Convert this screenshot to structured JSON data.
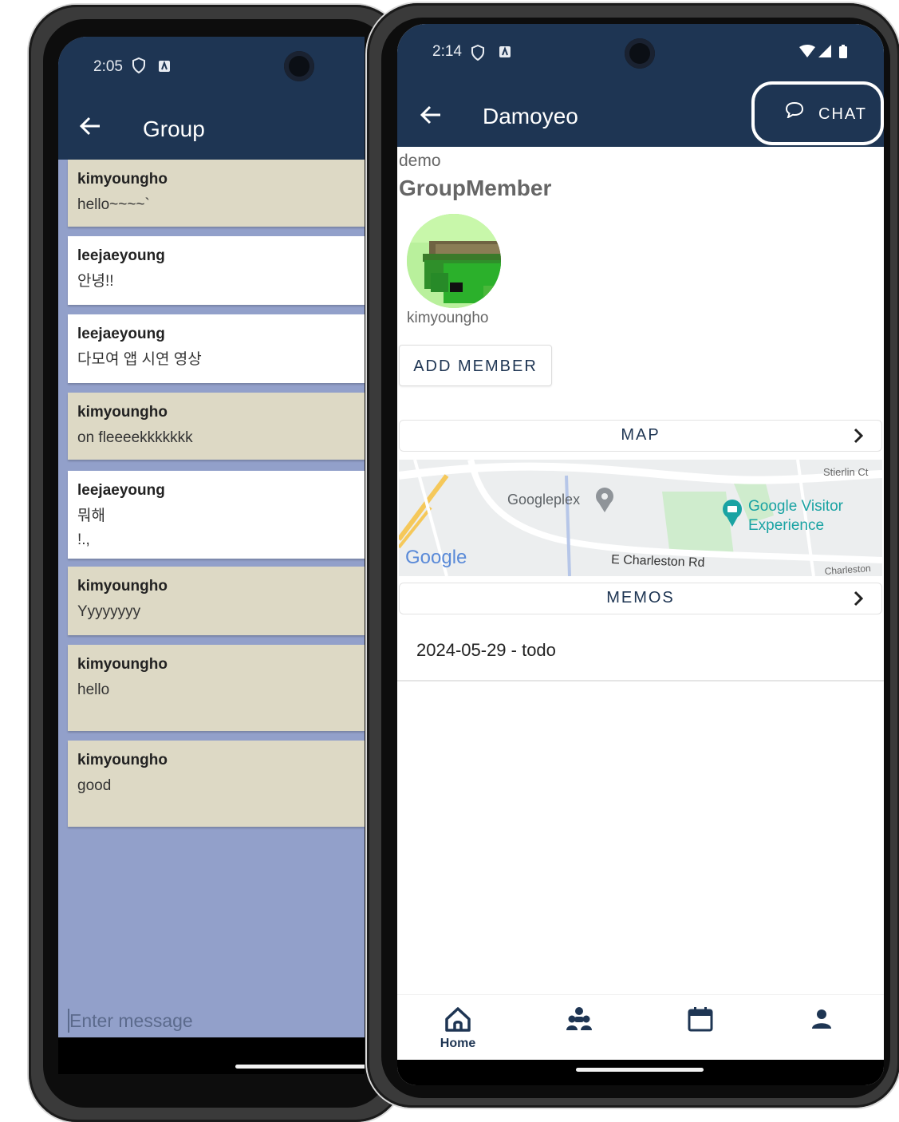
{
  "left_screen": {
    "status_time": "2:05",
    "title": "Group",
    "messages": [
      {
        "user": "kimyoungho",
        "text": "hello~~~~`",
        "type": "own"
      },
      {
        "user": "leejaeyoung",
        "text": "안녕!!",
        "type": "other"
      },
      {
        "user": "leejaeyoung",
        "text": "다모여 앱 시연 영상",
        "type": "other"
      },
      {
        "user": "kimyoungho",
        "text": "on fleeeekkkkkkk",
        "type": "own"
      },
      {
        "user": "leejaeyoung",
        "text": "뭐해\n!.,",
        "type": "other"
      },
      {
        "user": "kimyoungho",
        "text": "Yyyyyyyy",
        "type": "own"
      },
      {
        "user": "kimyoungho",
        "text": "hello",
        "type": "own"
      },
      {
        "user": "kimyoungho",
        "text": "good",
        "type": "own"
      }
    ],
    "input_placeholder": "Enter message"
  },
  "right_screen": {
    "status_time": "2:14",
    "title": "Damoyeo",
    "chat_label": "CHAT",
    "group_name": "demo",
    "section_title": "GroupMember",
    "members": [
      {
        "name": "kimyoungho"
      }
    ],
    "add_member_label": "ADD MEMBER",
    "map_label": "MAP",
    "map_labels": {
      "place1": "Googleplex",
      "place2": "Google Visitor",
      "place2b": "Experience",
      "road": "E Charleston Rd",
      "street1": "Stierlin Ct",
      "street2": "Charleston",
      "logo": "Google"
    },
    "memos_label": "MEMOS",
    "memos": [
      "2024-05-29 - todo"
    ],
    "bottom_nav": [
      {
        "label": "Home",
        "icon": "home-icon"
      },
      {
        "label": "",
        "icon": "group-icon"
      },
      {
        "label": "",
        "icon": "calendar-icon"
      },
      {
        "label": "",
        "icon": "person-icon"
      }
    ]
  },
  "colors": {
    "primary": "#1e3553",
    "chat_bg": "#92a0ca",
    "own_msg": "#ddd9c5",
    "other_msg": "#ffffff"
  }
}
